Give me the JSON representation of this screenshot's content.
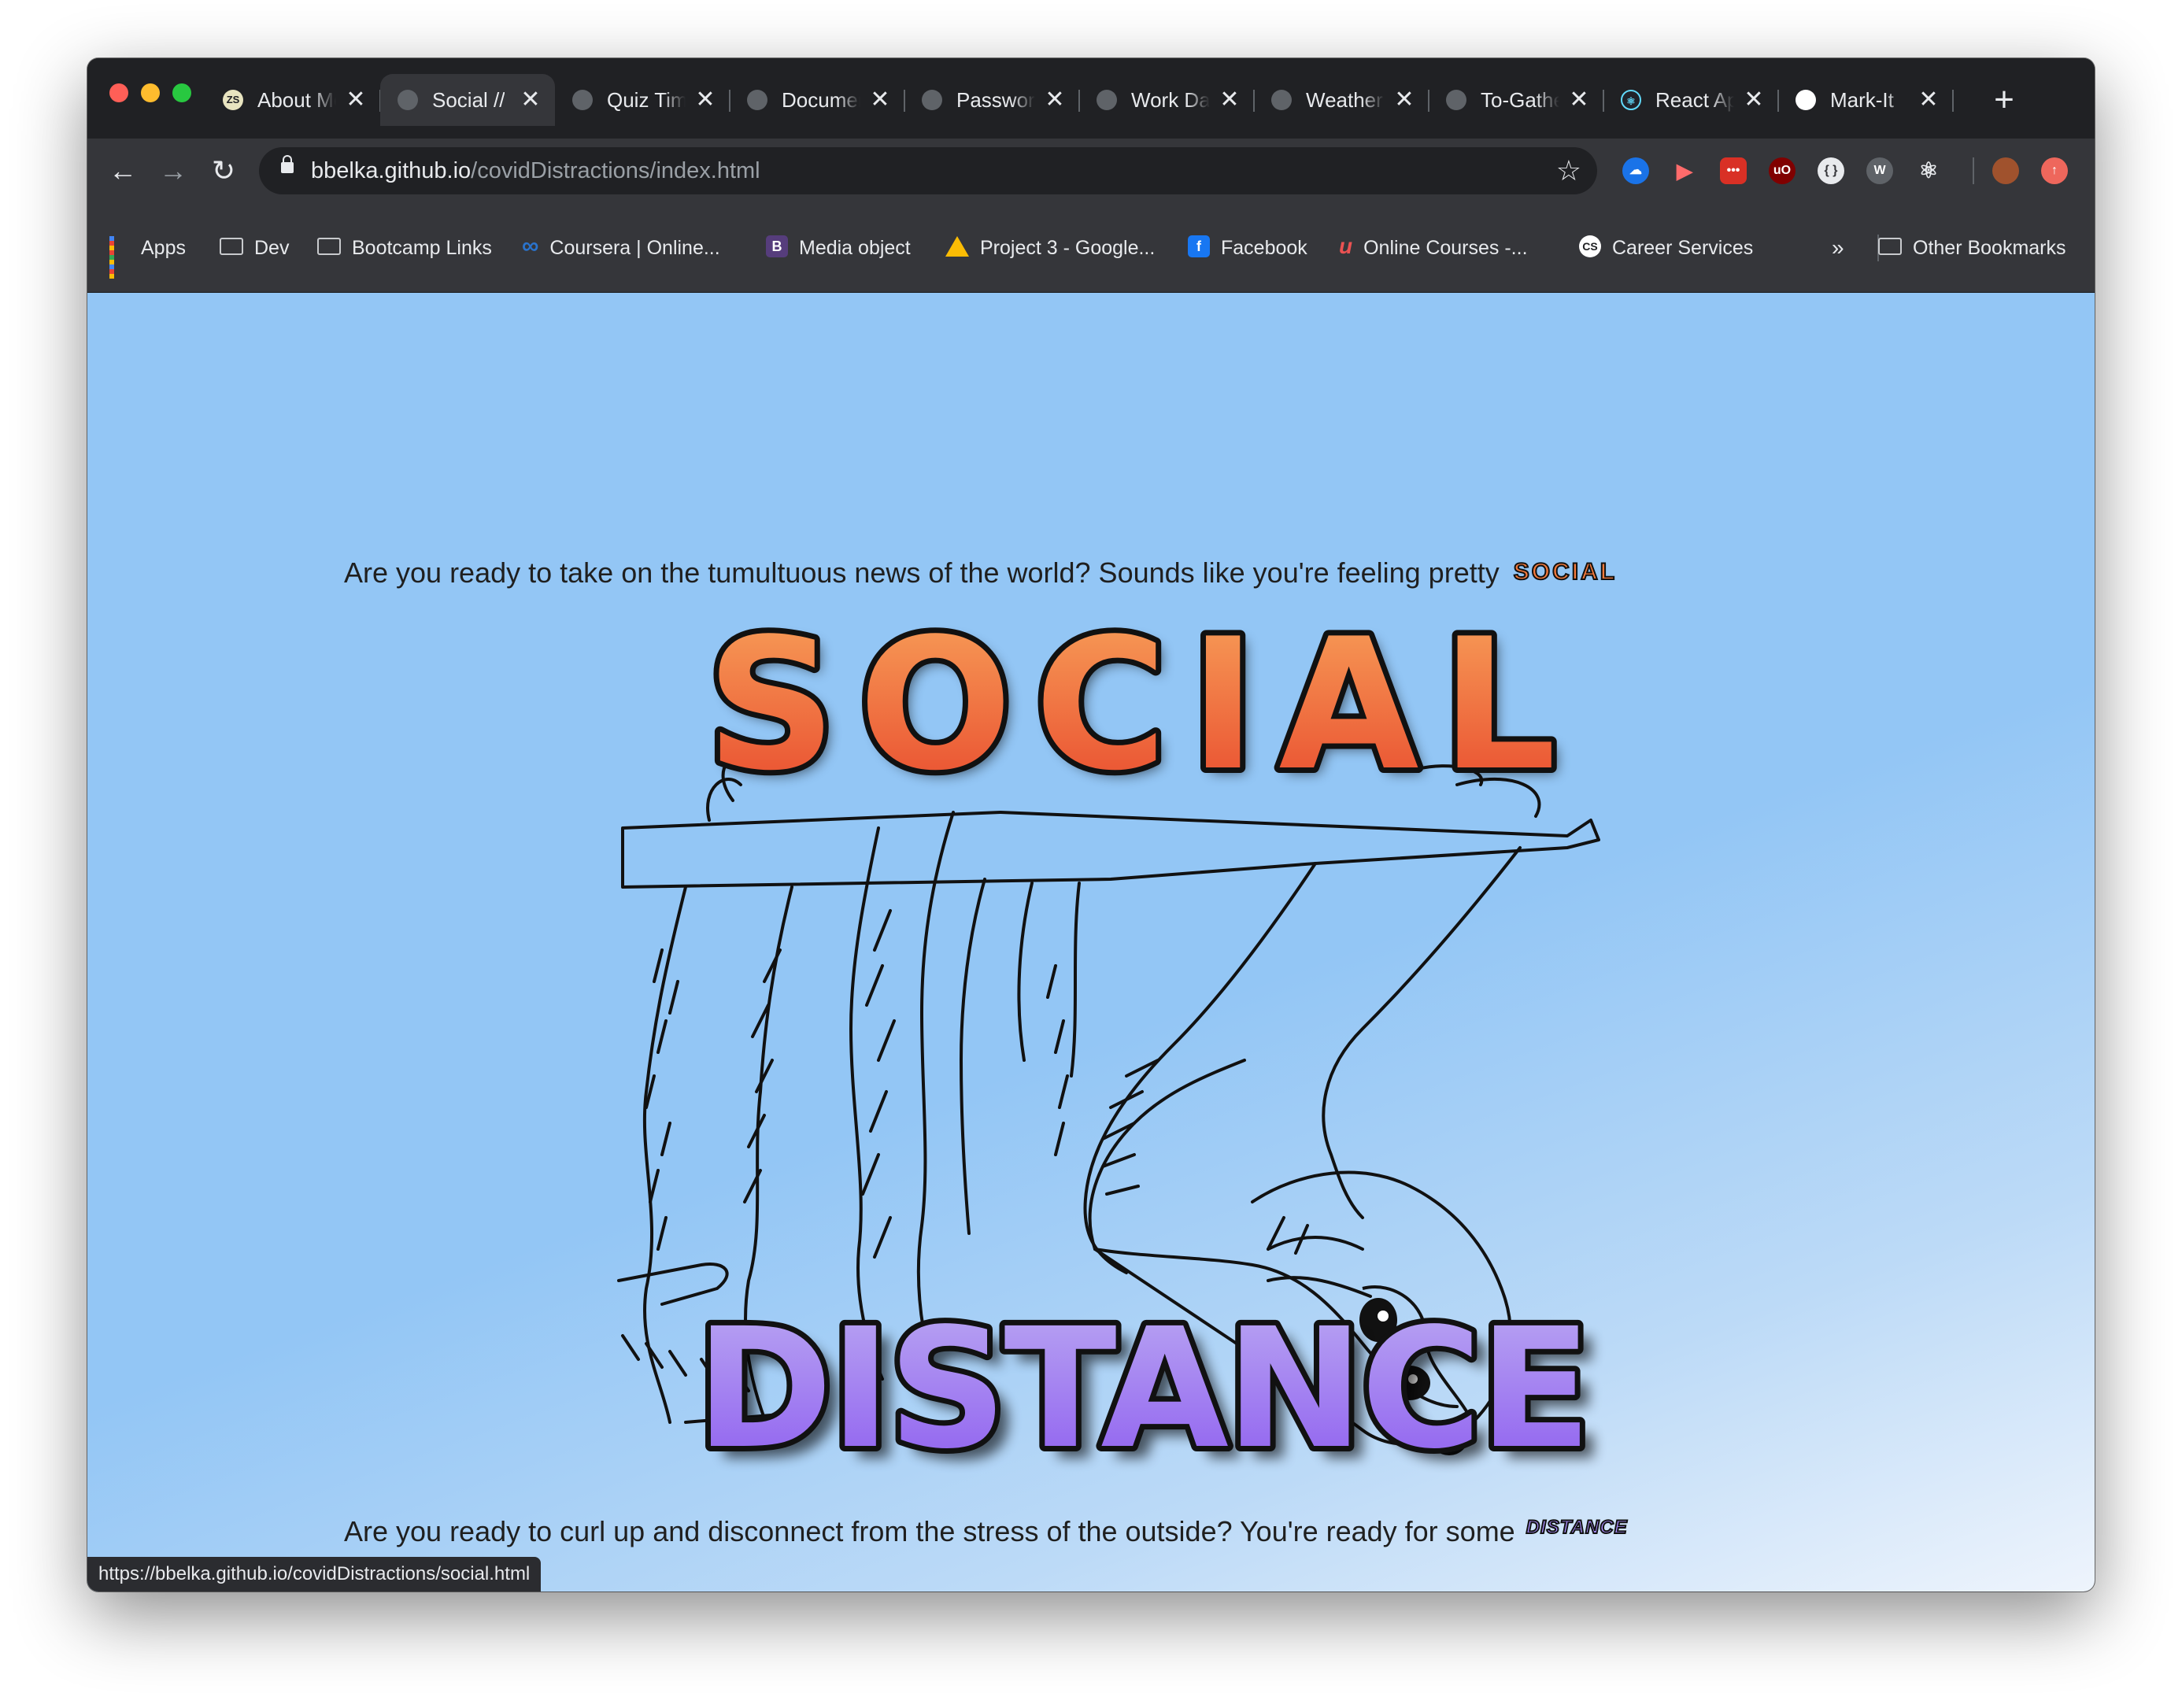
{
  "browser": {
    "tabs": [
      {
        "title": "About Me",
        "favicon": "ZS",
        "active": false
      },
      {
        "title": "Social // Distance",
        "favicon": "",
        "active": true
      },
      {
        "title": "Quiz Time",
        "favicon": "",
        "active": false
      },
      {
        "title": "Document",
        "favicon": "",
        "active": false
      },
      {
        "title": "Password Generator",
        "favicon": "",
        "active": false
      },
      {
        "title": "Work Day Scheduler",
        "favicon": "",
        "active": false
      },
      {
        "title": "Weather Dashboard",
        "favicon": "",
        "active": false
      },
      {
        "title": "To-Gather",
        "favicon": "",
        "active": false
      },
      {
        "title": "React App",
        "favicon": "",
        "active": false
      },
      {
        "title": "Mark-It",
        "favicon": "",
        "active": false
      }
    ],
    "new_tab_label": "+",
    "close_label": "✕",
    "url": {
      "host": "bbelka.github.io",
      "path": "/covidDistractions/index.html"
    },
    "bookmarks": [
      {
        "label": "Apps",
        "icon": "apps-grid-icon"
      },
      {
        "label": "Dev",
        "icon": "folder-icon"
      },
      {
        "label": "Bootcamp Links",
        "icon": "folder-icon"
      },
      {
        "label": "Coursera | Online...",
        "icon": "coursera-icon"
      },
      {
        "label": "Media object",
        "icon": "bootstrap-icon"
      },
      {
        "label": "Project 3 - Google...",
        "icon": "google-drive-icon"
      },
      {
        "label": "Facebook",
        "icon": "facebook-icon"
      },
      {
        "label": "Online Courses -...",
        "icon": "udemy-icon"
      },
      {
        "label": "Career Services",
        "icon": "cs-icon"
      }
    ],
    "overflow_label": "»",
    "other_bookmarks_label": "Other Bookmarks",
    "status_url": "https://bbelka.github.io/covidDistractions/social.html"
  },
  "page": {
    "social_line": "Are you ready to take on the tumultuous news of the world? Sounds like you're feeling pretty",
    "social_badge": "SOCIAL",
    "hero_top_word": "SOCIAL",
    "hero_bottom_word": "DISTANCE",
    "distance_line": "Are you ready to curl up and disconnect from the stress of the outside? You're ready for some",
    "distance_badge": "DISTANCE"
  },
  "colors": {
    "page_bg": "#93c6f5",
    "social_orange": "#f57a3c",
    "distance_purple": "#a78bfa"
  }
}
